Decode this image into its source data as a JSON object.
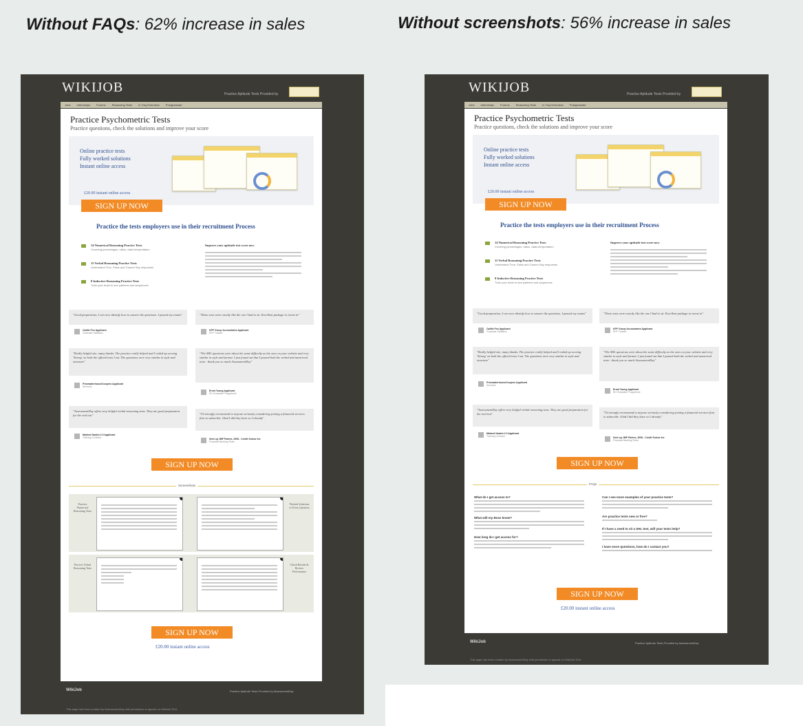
{
  "captions": {
    "left_bold": "Without FAQs",
    "left_rest": ": 62% increase in sales",
    "right_bold": "Without screenshots",
    "right_rest": ": 56% increase in sales"
  },
  "site": {
    "logo": "WIKIJOB",
    "provided_by": "Practice Aptitude Tests Provided by",
    "nav": [
      "Jobs",
      "Internships",
      "Forums",
      "Reasoning Tests",
      "In Tray Exercises",
      "Postgraduate"
    ],
    "title": "Practice Psychometric Tests",
    "subtitle": "Practice questions, check the solutions and improve your score",
    "hero_lines": [
      "Online practice tests",
      "Fully worked solutions",
      "Instant online access"
    ],
    "hero_price": "£20.00 instant online access",
    "cta": "SIGN UP NOW",
    "section_title": "Practice the tests employers use in their recruitment Process",
    "features": [
      {
        "title": "14 Numerical Reasoning Practice Tests",
        "sub": "Covering percentages, ratios, data interpretation"
      },
      {
        "title": "11 Verbal Reasoning Practice Tests",
        "sub": "Understand True, False and Cannot Say responses"
      },
      {
        "title": "8 Inductive Reasoning Practice Tests",
        "sub": "Train your brain to see patterns and sequences"
      }
    ],
    "improve_title": "Improve your aptitude test score now",
    "testimonials": [
      {
        "quote": "\"Good preparation, I can now identify how to answer the questions. I passed my exams\"",
        "name": "Caitlin Fox Applicant",
        "role": "Graduate Statistics"
      },
      {
        "quote": "\"These tests were exactly like the one I had to sit. Excellent package to invest in\"",
        "name": "KPF Group Accountants Applicant",
        "role": "KPF Trainee"
      },
      {
        "quote": "\"Really helpful site, many thanks. The practice really helped and I ended up scoring 'Strong' on both the official tests I sat. The questions were very similar in style and structure\"",
        "name": "PricewaterhouseCoopers Applicant",
        "role": "Services"
      },
      {
        "quote": "\"The SHL questions were about the same difficulty as the ones on your website and very similar in style and format. I just found out that I passed both the verbal and numerical tests - thank you so much AssessmentDay\"",
        "name": "Ernst Young Applicant",
        "role": "SH Graduate Programme"
      },
      {
        "quote": "\"AssessmentDay offers very helpful verbal reasoning tests. They are good preparation for the real test\"",
        "name": "Marked Naskin 2.0 Applicant",
        "role": "Training Contract"
      },
      {
        "quote": "\"I'd strongly recommend to anyone seriously considering joining a financial services firm to subscribe. Glad I did they have so I already\"",
        "name": "Sent up JMP Parkes, 2008 - Credit Suisse Inc",
        "role": "Financial Banking Team"
      }
    ],
    "screenshots_label": "Screenshots",
    "shot_labels": [
      "Practice Numerical Reasoning Tests",
      "Worked Solutions to Every Question",
      "Practice Verbal Reasoning Tests",
      "Check Results & Review Performance"
    ],
    "faqs_label": "FAQs",
    "faqs": [
      "What do I get access to?",
      "What will my Boss know?",
      "How long do I get access for?",
      "Can I see more examples of your practice tests?",
      "Are practice tests new or free?",
      "If I have a need to sit a SHL test, will your tests help?",
      "I have more questions, how do I contact you?"
    ],
    "cta_price": "£20.00 instant online access",
    "footer_brand": "WikiJob",
    "footer_right": "Practice Aptitude Tests Provided by AssessmentDay",
    "footer_note": "This page has been created by AssessmentDay with permission to appear on WikiJob 2011"
  }
}
